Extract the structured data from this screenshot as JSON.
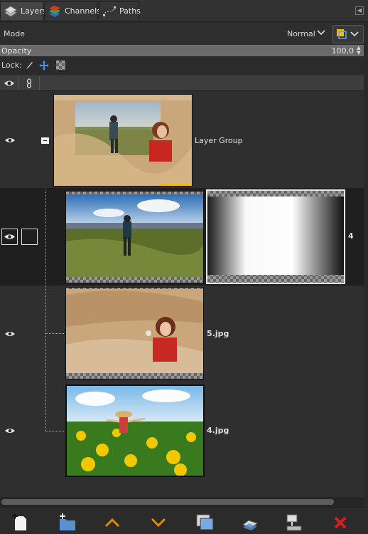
{
  "tabs": [
    {
      "label": "Layers",
      "icon": "layers-icon"
    },
    {
      "label": "Channels",
      "icon": "channels-icon"
    },
    {
      "label": "Paths",
      "icon": "paths-icon"
    }
  ],
  "mode": {
    "label": "Mode",
    "value": "Normal"
  },
  "opacity": {
    "label": "Opacity",
    "value": "100,0",
    "level": 1.0
  },
  "lock": {
    "label": "Lock:"
  },
  "layers": [
    {
      "name": "Layer Group",
      "type": "group",
      "visible": true
    },
    {
      "name": "4",
      "type": "layer-with-mask",
      "visible": true,
      "selected": true
    },
    {
      "name": "5.jpg",
      "type": "layer",
      "visible": true
    },
    {
      "name": "4.jpg",
      "type": "layer",
      "visible": true
    }
  ],
  "colors": {
    "accent": "#f0c000",
    "delete": "#d42020",
    "raise": "#e08a00"
  }
}
